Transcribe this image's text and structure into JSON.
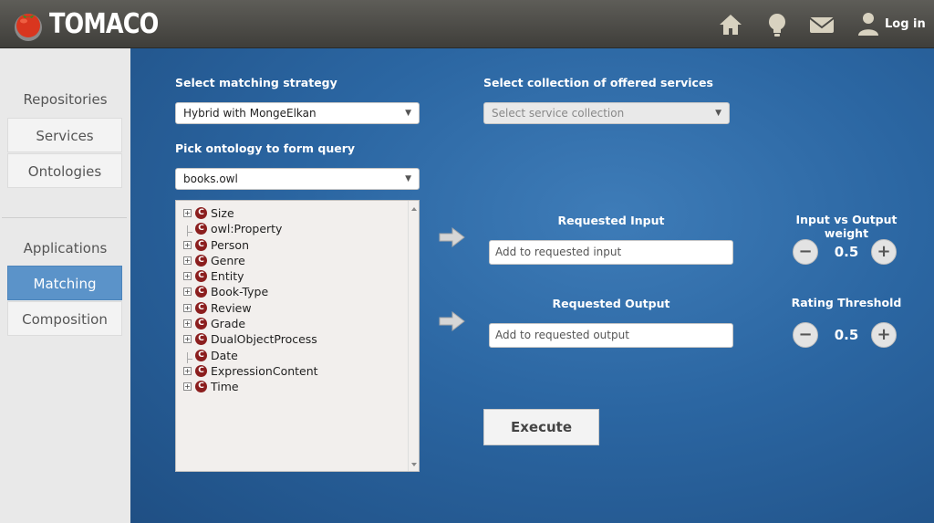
{
  "header": {
    "app_name": "TOMACO",
    "login_label": "Log in",
    "icons": [
      "home-icon",
      "lightbulb-icon",
      "mail-icon",
      "user-icon"
    ]
  },
  "sidebar": {
    "section_repositories": "Repositories",
    "section_applications": "Applications",
    "items": [
      {
        "label": "Services",
        "active": false
      },
      {
        "label": "Ontologies",
        "active": false
      },
      {
        "label": "Matching",
        "active": true
      },
      {
        "label": "Composition",
        "active": false
      }
    ]
  },
  "main": {
    "strategy_label": "Select matching strategy",
    "strategy_value": "Hybrid with MongeElkan",
    "collection_label": "Select collection of offered services",
    "collection_placeholder": "Select service collection",
    "ontology_label": "Pick ontology to form query",
    "ontology_value": "books.owl",
    "tree": [
      {
        "label": "Size",
        "expandable": true
      },
      {
        "label": "owl:Property",
        "expandable": false
      },
      {
        "label": "Person",
        "expandable": true
      },
      {
        "label": "Genre",
        "expandable": true
      },
      {
        "label": "Entity",
        "expandable": true
      },
      {
        "label": "Book-Type",
        "expandable": true
      },
      {
        "label": "Review",
        "expandable": true
      },
      {
        "label": "Grade",
        "expandable": true
      },
      {
        "label": "DualObjectProcess",
        "expandable": true
      },
      {
        "label": "Date",
        "expandable": false
      },
      {
        "label": "ExpressionContent",
        "expandable": true
      },
      {
        "label": "Time",
        "expandable": true
      }
    ],
    "class_badge": "C",
    "requested_input_label": "Requested Input",
    "requested_input_placeholder": "Add to requested input",
    "requested_output_label": "Requested Output",
    "requested_output_placeholder": "Add to requested output",
    "weight_label": "Input vs Output weight",
    "weight_value": "0.5",
    "threshold_label": "Rating Threshold",
    "threshold_value": "0.5",
    "minus": "−",
    "plus": "+",
    "execute_label": "Execute"
  },
  "colors": {
    "accent": "#5b93c9",
    "main_bg": "#2b66a2",
    "header_bg": "#4a4945"
  }
}
